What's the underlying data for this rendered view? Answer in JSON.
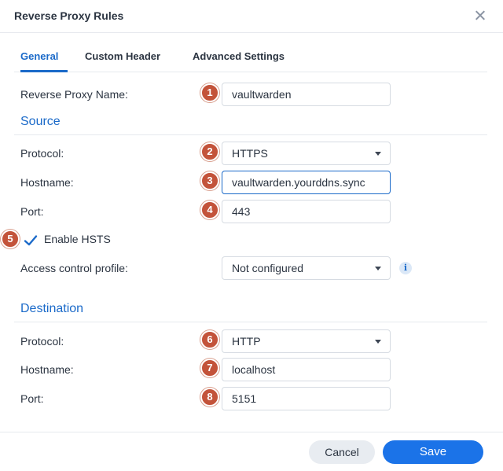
{
  "dialog": {
    "title": "Reverse Proxy Rules"
  },
  "tabs": [
    {
      "label": "General",
      "active": true
    },
    {
      "label": "Custom Header",
      "active": false
    },
    {
      "label": "Advanced Settings",
      "active": false
    }
  ],
  "general": {
    "name_label": "Reverse Proxy Name:",
    "name_value": "vaultwarden",
    "name_badge": "1"
  },
  "source": {
    "heading": "Source",
    "protocol_label": "Protocol:",
    "protocol_value": "HTTPS",
    "protocol_badge": "2",
    "hostname_label": "Hostname:",
    "hostname_value": "vaultwarden.yourddns.sync",
    "hostname_badge": "3",
    "port_label": "Port:",
    "port_value": "443",
    "port_badge": "4",
    "hsts_label": "Enable HSTS",
    "hsts_checked": true,
    "hsts_badge": "5",
    "acl_label": "Access control profile:",
    "acl_value": "Not configured",
    "info_icon": "i"
  },
  "destination": {
    "heading": "Destination",
    "protocol_label": "Protocol:",
    "protocol_value": "HTTP",
    "protocol_badge": "6",
    "hostname_label": "Hostname:",
    "hostname_value": "localhost",
    "hostname_badge": "7",
    "port_label": "Port:",
    "port_value": "5151",
    "port_badge": "8"
  },
  "footer": {
    "cancel_label": "Cancel",
    "save_label": "Save"
  },
  "colors": {
    "accent": "#1b6ac9",
    "badge": "#c3533a",
    "save_button": "#1b73e8"
  },
  "icons": {
    "close": "close-icon",
    "dropdown": "chevron-down-icon",
    "check": "check-icon",
    "info": "info-icon"
  }
}
